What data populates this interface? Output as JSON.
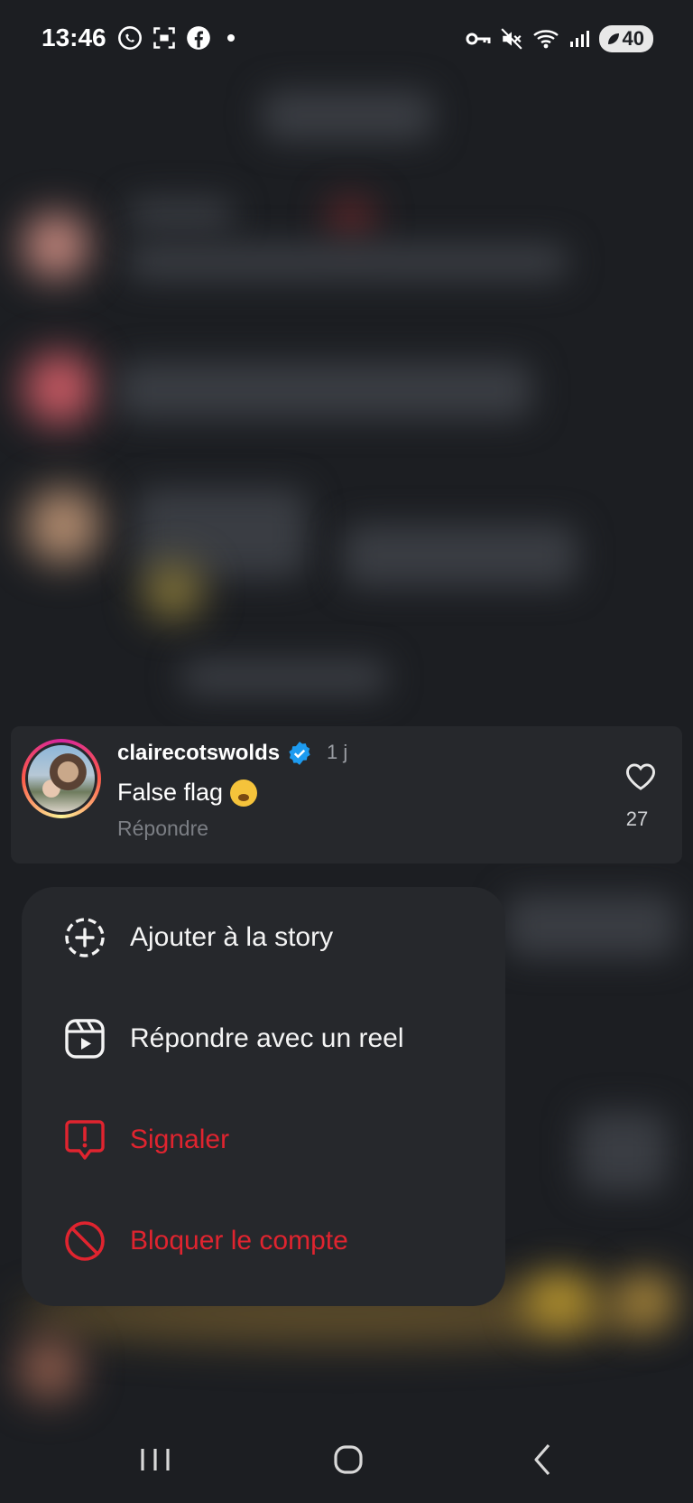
{
  "status_bar": {
    "time": "13:46",
    "battery": "40",
    "left_icons": [
      "whatsapp-icon",
      "screenshot-icon",
      "facebook-icon",
      "notification-dot"
    ],
    "right_icons": [
      "vpn-key-icon",
      "mute-icon",
      "wifi-icon",
      "signal-icon",
      "battery-icon"
    ]
  },
  "comment": {
    "username": "clairecotswolds",
    "time_ago": "1 j",
    "text": "False flag",
    "emoji": "yawning-face-emoji",
    "reply_label": "Répondre",
    "likes": "27"
  },
  "menu": {
    "items": [
      {
        "label": "Ajouter à la story",
        "icon": "add-story-icon",
        "color": "#f4f4f4"
      },
      {
        "label": "Répondre avec un reel",
        "icon": "reel-icon",
        "color": "#f4f4f4"
      },
      {
        "label": "Signaler",
        "icon": "report-icon",
        "color": "#e0242f"
      },
      {
        "label": "Bloquer le compte",
        "icon": "block-icon",
        "color": "#e0242f"
      }
    ]
  },
  "colors": {
    "background": "#1c1e22",
    "card": "#26282c",
    "danger": "#e0242f",
    "verified": "#1d9bf0"
  }
}
